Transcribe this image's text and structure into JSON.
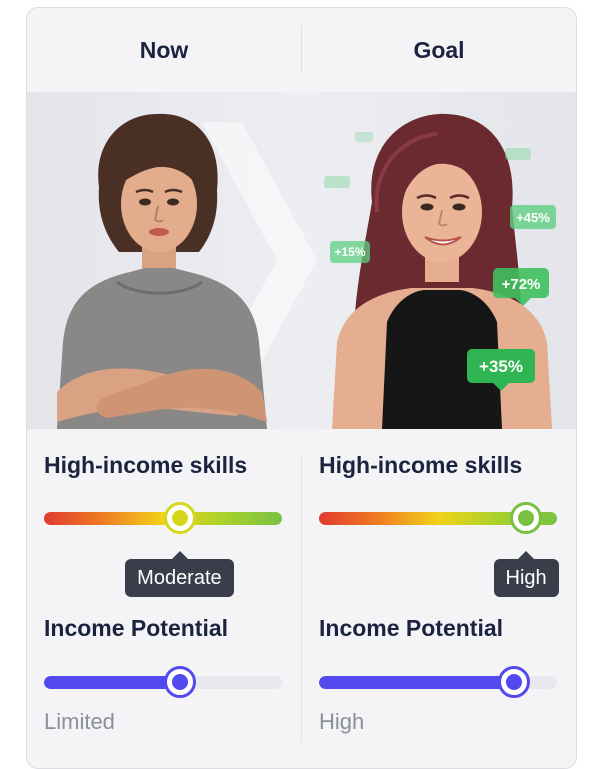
{
  "header": {
    "now_label": "Now",
    "goal_label": "Goal"
  },
  "hero": {
    "badges": [
      "+15%",
      "+45%",
      "+72%",
      "+35%"
    ]
  },
  "now": {
    "skills_label": "High-income skills",
    "skills_level": 0.57,
    "skills_knob_color": "#d4d81b",
    "skills_tooltip": "Moderate",
    "income_label": "Income Potential",
    "income_level": 0.57,
    "income_value": "Limited"
  },
  "goal": {
    "skills_label": "High-income skills",
    "skills_level": 0.87,
    "skills_knob_color": "#7ac142",
    "skills_tooltip": "High",
    "income_label": "Income Potential",
    "income_level": 0.82,
    "income_value": "High"
  },
  "colors": {
    "accent": "#5249ef",
    "badge_green": "#3fbf5f",
    "text_dark": "#1c2340",
    "text_muted": "#8a8f9c",
    "tooltip_bg": "#3a3e4a"
  }
}
